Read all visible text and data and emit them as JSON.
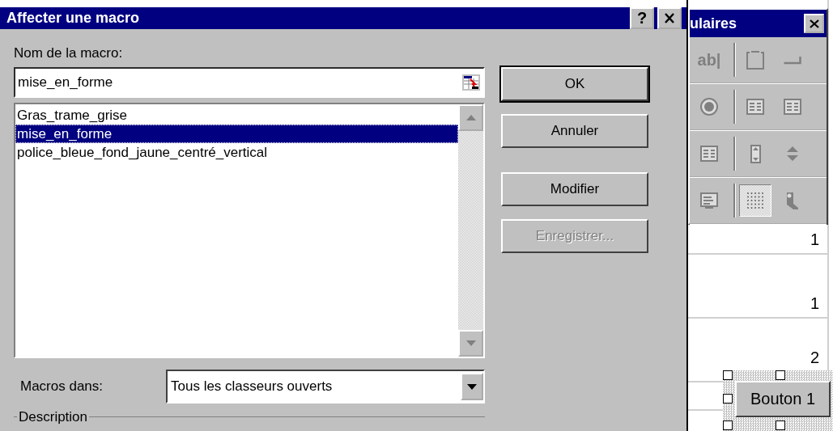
{
  "dialog": {
    "title": "Affecter une macro",
    "help_button": "?"
  },
  "macro_name": {
    "label": "Nom de la macro:",
    "value": "mise_en_forme"
  },
  "macros": [
    {
      "label": "Gras_trame_grise",
      "selected": false
    },
    {
      "label": "mise_en_forme",
      "selected": true
    },
    {
      "label": "police_bleue_fond_jaune_centré_vertical",
      "selected": false
    }
  ],
  "buttons": [
    {
      "label": "OK",
      "default": true,
      "disabled": false
    },
    {
      "label": "Annuler",
      "default": false,
      "disabled": false
    },
    {
      "label": "Modifier",
      "default": false,
      "disabled": false
    },
    {
      "label": "Enregistrer...",
      "default": false,
      "disabled": true
    }
  ],
  "macros_in": {
    "label": "Macros dans:",
    "value": "Tous les classeurs ouverts"
  },
  "description": {
    "label": "Description"
  },
  "toolbar": {
    "title": "ulaires",
    "tools": [
      {
        "kind": "editbox",
        "glyph": "ab|",
        "pressed": false
      },
      {
        "kind": "groupbox",
        "pressed": false
      },
      {
        "kind": "button",
        "pressed": false
      },
      {
        "kind": "radio",
        "pressed": false
      },
      {
        "kind": "listbox",
        "pressed": false
      },
      {
        "kind": "combolist",
        "pressed": false
      },
      {
        "kind": "combodrop",
        "pressed": false
      },
      {
        "kind": "scrollbar",
        "pressed": false
      },
      {
        "kind": "spinner",
        "pressed": false
      },
      {
        "kind": "properties",
        "pressed": false
      },
      {
        "kind": "grid",
        "pressed": true
      },
      {
        "kind": "run",
        "pressed": false
      }
    ]
  },
  "sheet": {
    "cells": [
      "1",
      "1",
      "2"
    ]
  },
  "form_button": {
    "label": "Bouton 1"
  }
}
